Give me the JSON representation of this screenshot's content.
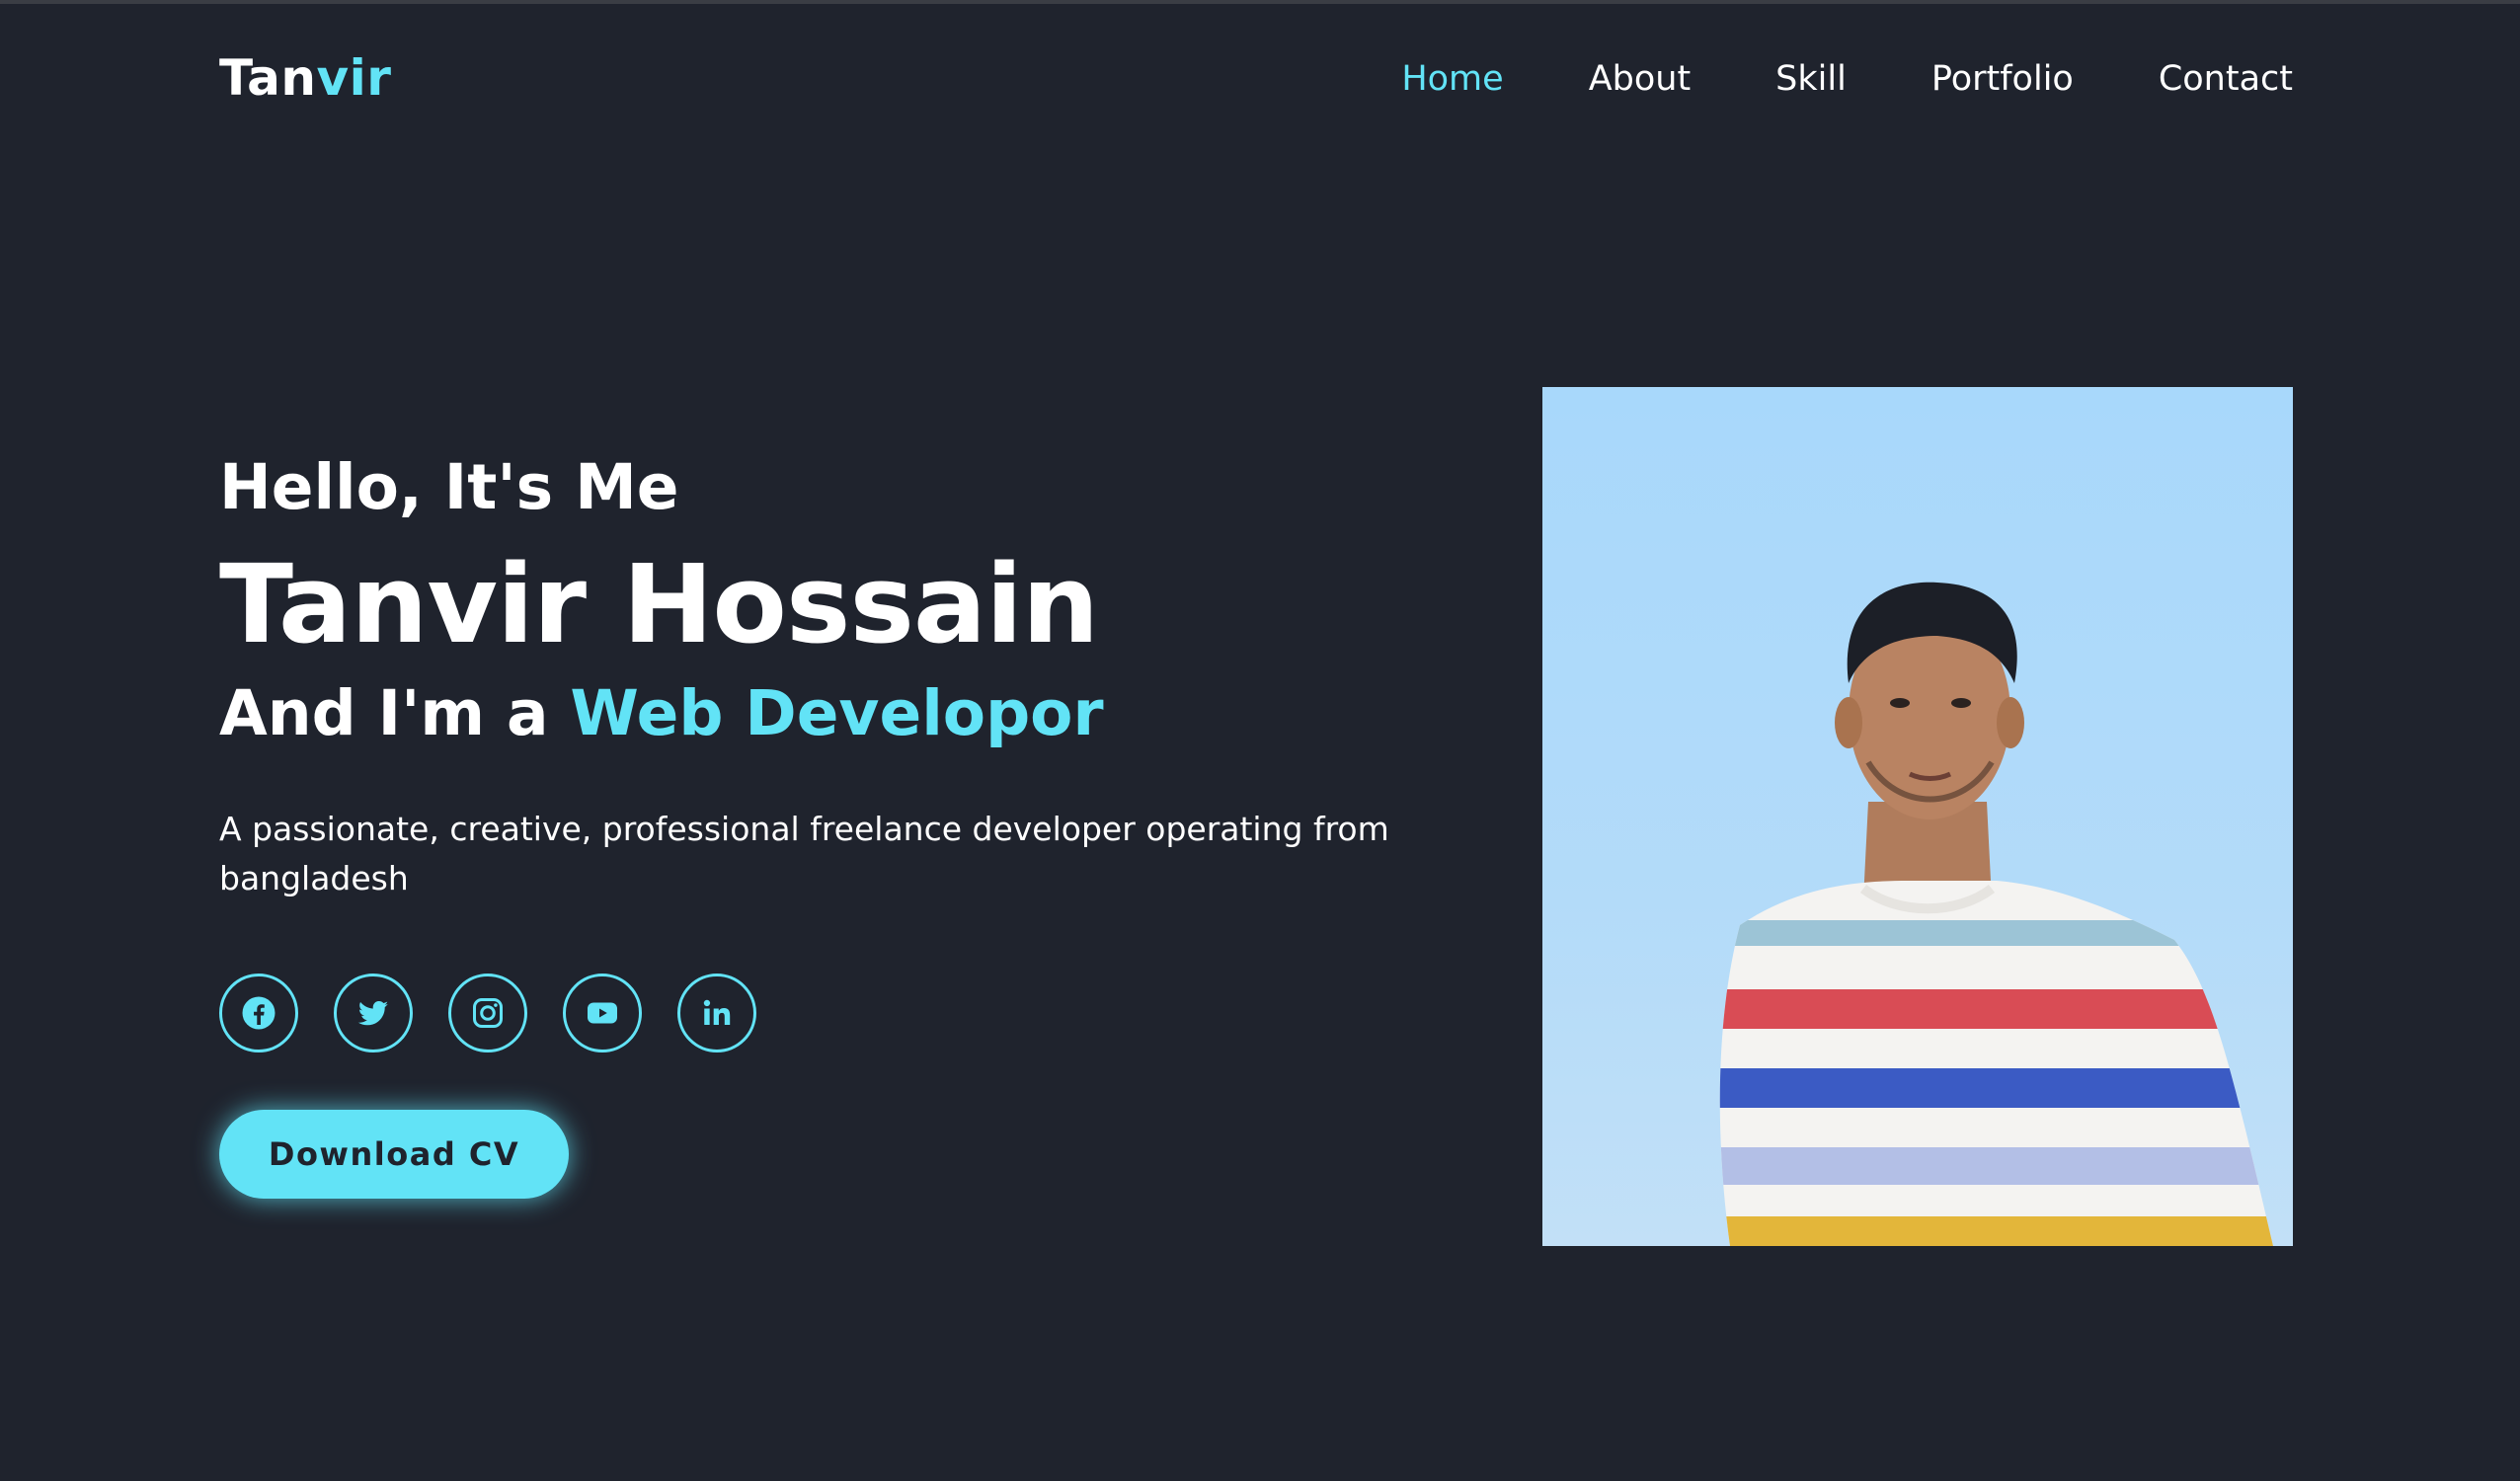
{
  "logo": {
    "part1": "Tan",
    "part2": "vir"
  },
  "nav": {
    "home": "Home",
    "about": "About",
    "skill": "Skill",
    "portfolio": "Portfolio",
    "contact": "Contact"
  },
  "hero": {
    "greeting": "Hello, It's Me",
    "name": "Tanvir Hossain",
    "role_prefix": "And I'm a ",
    "role_highlight": "Web Developor",
    "description": "A passionate, creative, professional freelance developer operating from bangladesh"
  },
  "socials": [
    "facebook-icon",
    "twitter-icon",
    "instagram-icon",
    "youtube-icon",
    "linkedin-icon"
  ],
  "cta": {
    "label": "Download CV"
  },
  "colors": {
    "accent": "#62e3f6",
    "background": "#1f232d",
    "text": "#ffffff"
  }
}
